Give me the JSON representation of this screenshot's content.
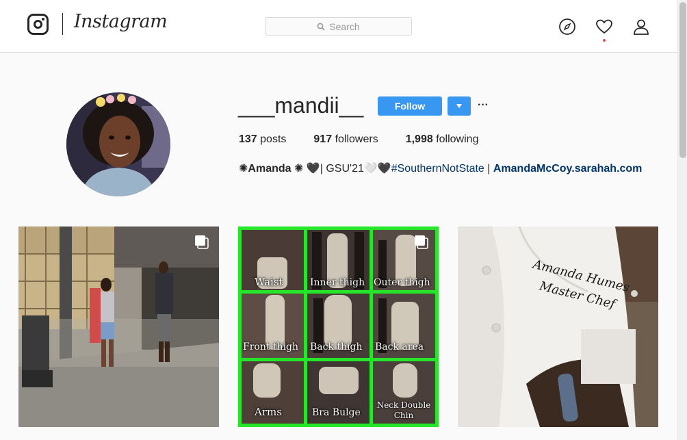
{
  "header": {
    "wordmark": "Instagram",
    "search_placeholder": "Search",
    "icons": [
      "instagram-logo-icon",
      "compass-icon",
      "heart-icon",
      "profile-icon"
    ],
    "notification_color": "#ed4956"
  },
  "profile": {
    "username": "___mandii__",
    "follow_label": "Follow",
    "more_label": "···",
    "stats": {
      "posts_count": "137",
      "posts_label": "posts",
      "followers_count": "917",
      "followers_label": "followers",
      "following_count": "1,998",
      "following_label": "following"
    },
    "bio": {
      "prefix": "✺",
      "name": "Amanda",
      "middle": " ✺ 🖤| GSU'21🤍🖤",
      "hashtag": "#SouthernNotState",
      "separator": " | ",
      "link": "AmandaMcCoy.sarahah.com"
    },
    "accent_color": "#3897f0"
  },
  "posts": [
    {
      "kind": "street-photo",
      "multi": true
    },
    {
      "kind": "collage",
      "multi": true,
      "labels": [
        "Waist",
        "Inner thigh",
        "Outer thigh",
        "Front thigh",
        "Back thigh",
        "Back area",
        "Arms",
        "Bra Bulge",
        "Neck Double Chin"
      ]
    },
    {
      "kind": "chef-coat",
      "multi": false,
      "embroidery_line1": "Amanda Humes",
      "embroidery_line2": "Master Chef"
    }
  ]
}
